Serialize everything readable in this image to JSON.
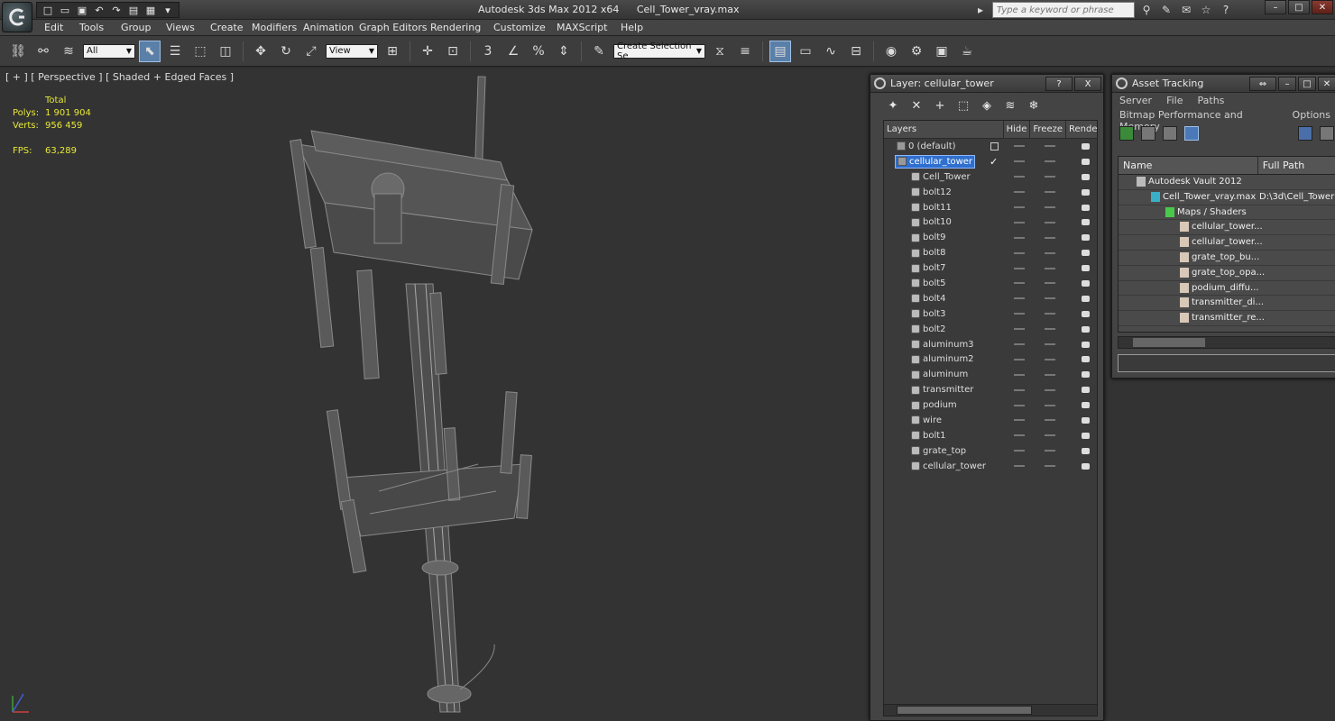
{
  "titlebar": {
    "app_name": "Autodesk 3ds Max  2012 x64",
    "file_name": "Cell_Tower_vray.max",
    "search_placeholder": "Type a keyword or phrase"
  },
  "menu": [
    "Edit",
    "Tools",
    "Group",
    "Views",
    "Create",
    "Modifiers",
    "Animation",
    "Graph Editors",
    "Rendering",
    "Customize",
    "MAXScript",
    "Help"
  ],
  "toolbar": {
    "selection_filter": "All",
    "reference_coord": "View",
    "named_selection_placeholder": "Create Selection Se",
    "snap_3": "3"
  },
  "viewport": {
    "label": "[ + ] [ Perspective ] [ Shaded + Edged Faces ]",
    "stats_header": "Total",
    "polys_label": "Polys:",
    "polys_value": "1 901 904",
    "verts_label": "Verts:",
    "verts_value": "956 459",
    "fps_label": "FPS:",
    "fps_value": "63,289"
  },
  "layer_panel": {
    "title": "Layer: cellular_tower",
    "help": "?",
    "close": "X",
    "columns": [
      "Layers",
      "Hide",
      "Freeze",
      "Rende"
    ],
    "rows": [
      {
        "name": "0 (default)",
        "level": 0,
        "kind": "layer"
      },
      {
        "name": "cellular_tower",
        "level": 0,
        "kind": "layer",
        "selected": true
      },
      {
        "name": "Cell_Tower",
        "level": 1,
        "kind": "object"
      },
      {
        "name": "bolt12",
        "level": 1,
        "kind": "object"
      },
      {
        "name": "bolt11",
        "level": 1,
        "kind": "object"
      },
      {
        "name": "bolt10",
        "level": 1,
        "kind": "object"
      },
      {
        "name": "bolt9",
        "level": 1,
        "kind": "object"
      },
      {
        "name": "bolt8",
        "level": 1,
        "kind": "object"
      },
      {
        "name": "bolt7",
        "level": 1,
        "kind": "object"
      },
      {
        "name": "bolt5",
        "level": 1,
        "kind": "object"
      },
      {
        "name": "bolt4",
        "level": 1,
        "kind": "object"
      },
      {
        "name": "bolt3",
        "level": 1,
        "kind": "object"
      },
      {
        "name": "bolt2",
        "level": 1,
        "kind": "object"
      },
      {
        "name": "aluminum3",
        "level": 1,
        "kind": "object"
      },
      {
        "name": "aluminum2",
        "level": 1,
        "kind": "object"
      },
      {
        "name": "aluminum",
        "level": 1,
        "kind": "object"
      },
      {
        "name": "transmitter",
        "level": 1,
        "kind": "object"
      },
      {
        "name": "podium",
        "level": 1,
        "kind": "object"
      },
      {
        "name": "wire",
        "level": 1,
        "kind": "object"
      },
      {
        "name": "bolt1",
        "level": 1,
        "kind": "object"
      },
      {
        "name": "grate_top",
        "level": 1,
        "kind": "object"
      },
      {
        "name": "cellular_tower",
        "level": 1,
        "kind": "object"
      }
    ]
  },
  "asset_panel": {
    "title": "Asset Tracking",
    "menu_row1": [
      "Server",
      "File",
      "Paths"
    ],
    "menu_row2": [
      "Bitmap Performance and Memory",
      "Options"
    ],
    "columns": [
      "Name",
      "Full Path"
    ],
    "rows": [
      {
        "name": "Autodesk Vault 2012",
        "path": "",
        "level": 0,
        "icon": "vault-icon"
      },
      {
        "name": "Cell_Tower_vray.max",
        "path": "D:\\3d\\Cell_Tower",
        "level": 1,
        "icon": "max-file-icon"
      },
      {
        "name": "Maps / Shaders",
        "path": "",
        "level": 2,
        "icon": "maps-icon"
      },
      {
        "name": "cellular_tower...",
        "path": "",
        "level": 3,
        "icon": "bitmap-icon"
      },
      {
        "name": "cellular_tower...",
        "path": "",
        "level": 3,
        "icon": "bitmap-icon"
      },
      {
        "name": "grate_top_bu...",
        "path": "",
        "level": 3,
        "icon": "bitmap-icon"
      },
      {
        "name": "grate_top_opa...",
        "path": "",
        "level": 3,
        "icon": "bitmap-icon"
      },
      {
        "name": "podium_diffu...",
        "path": "",
        "level": 3,
        "icon": "bitmap-icon"
      },
      {
        "name": "transmitter_di...",
        "path": "",
        "level": 3,
        "icon": "bitmap-icon"
      },
      {
        "name": "transmitter_re...",
        "path": "",
        "level": 3,
        "icon": "bitmap-icon"
      }
    ]
  },
  "colors": {
    "stats_text": "#e8e838",
    "selection": "#2f6fcf",
    "viewport_bg": "#333333"
  }
}
